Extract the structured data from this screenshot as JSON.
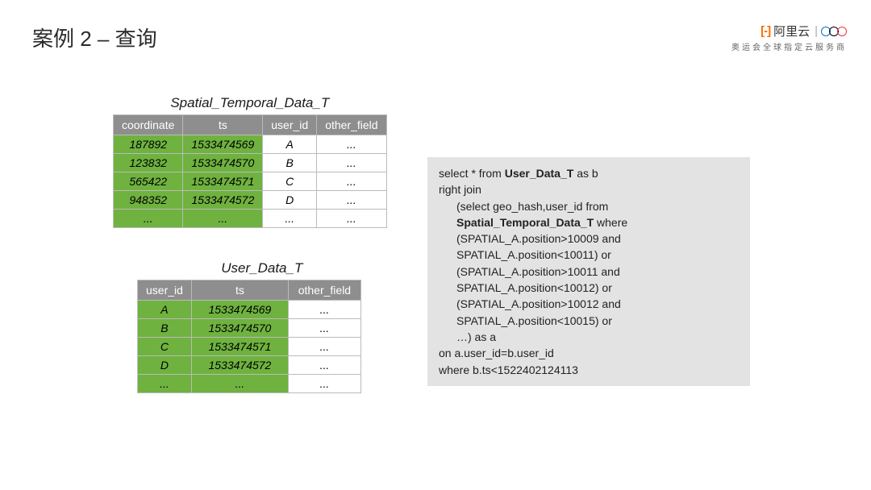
{
  "title": "案例 2 – 查询",
  "brand": {
    "logo_bracket": "[-]",
    "logo_text": "阿里云",
    "subtitle": "奥运会全球指定云服务商"
  },
  "table1": {
    "title": "Spatial_Temporal_Data_T",
    "headers": [
      "coordinate",
      "ts",
      "user_id",
      "other_field"
    ],
    "rows": [
      [
        "187892",
        "1533474569",
        "A",
        "..."
      ],
      [
        "123832",
        "1533474570",
        "B",
        "..."
      ],
      [
        "565422",
        "1533474571",
        "C",
        "..."
      ],
      [
        "948352",
        "1533474572",
        "D",
        "..."
      ],
      [
        "...",
        "...",
        "...",
        "..."
      ]
    ]
  },
  "table2": {
    "title": "User_Data_T",
    "headers": [
      "user_id",
      "ts",
      "other_field"
    ],
    "rows": [
      [
        "A",
        "1533474569",
        "..."
      ],
      [
        "B",
        "1533474570",
        "..."
      ],
      [
        "C",
        "1533474571",
        "..."
      ],
      [
        "D",
        "1533474572",
        "..."
      ],
      [
        "...",
        "...",
        "..."
      ]
    ]
  },
  "sql": {
    "l1a": "select * from ",
    "l1b": "User_Data_T",
    "l1c": " as b",
    "l2": "right join",
    "l3": "(select geo_hash,user_id from",
    "l4": "Spatial_Temporal_Data_T",
    "l4b": " where",
    "l5": "(SPATIAL_A.position>10009 and",
    "l6": "SPATIAL_A.position<10011) or",
    "l7": "(SPATIAL_A.position>10011 and",
    "l8": "SPATIAL_A.position<10012) or",
    "l9": "(SPATIAL_A.position>10012 and",
    "l10": "SPATIAL_A.position<10015) or",
    "l11": "…) as a",
    "l12": "on a.user_id=b.user_id",
    "l13": "where b.ts<1522402124113"
  }
}
